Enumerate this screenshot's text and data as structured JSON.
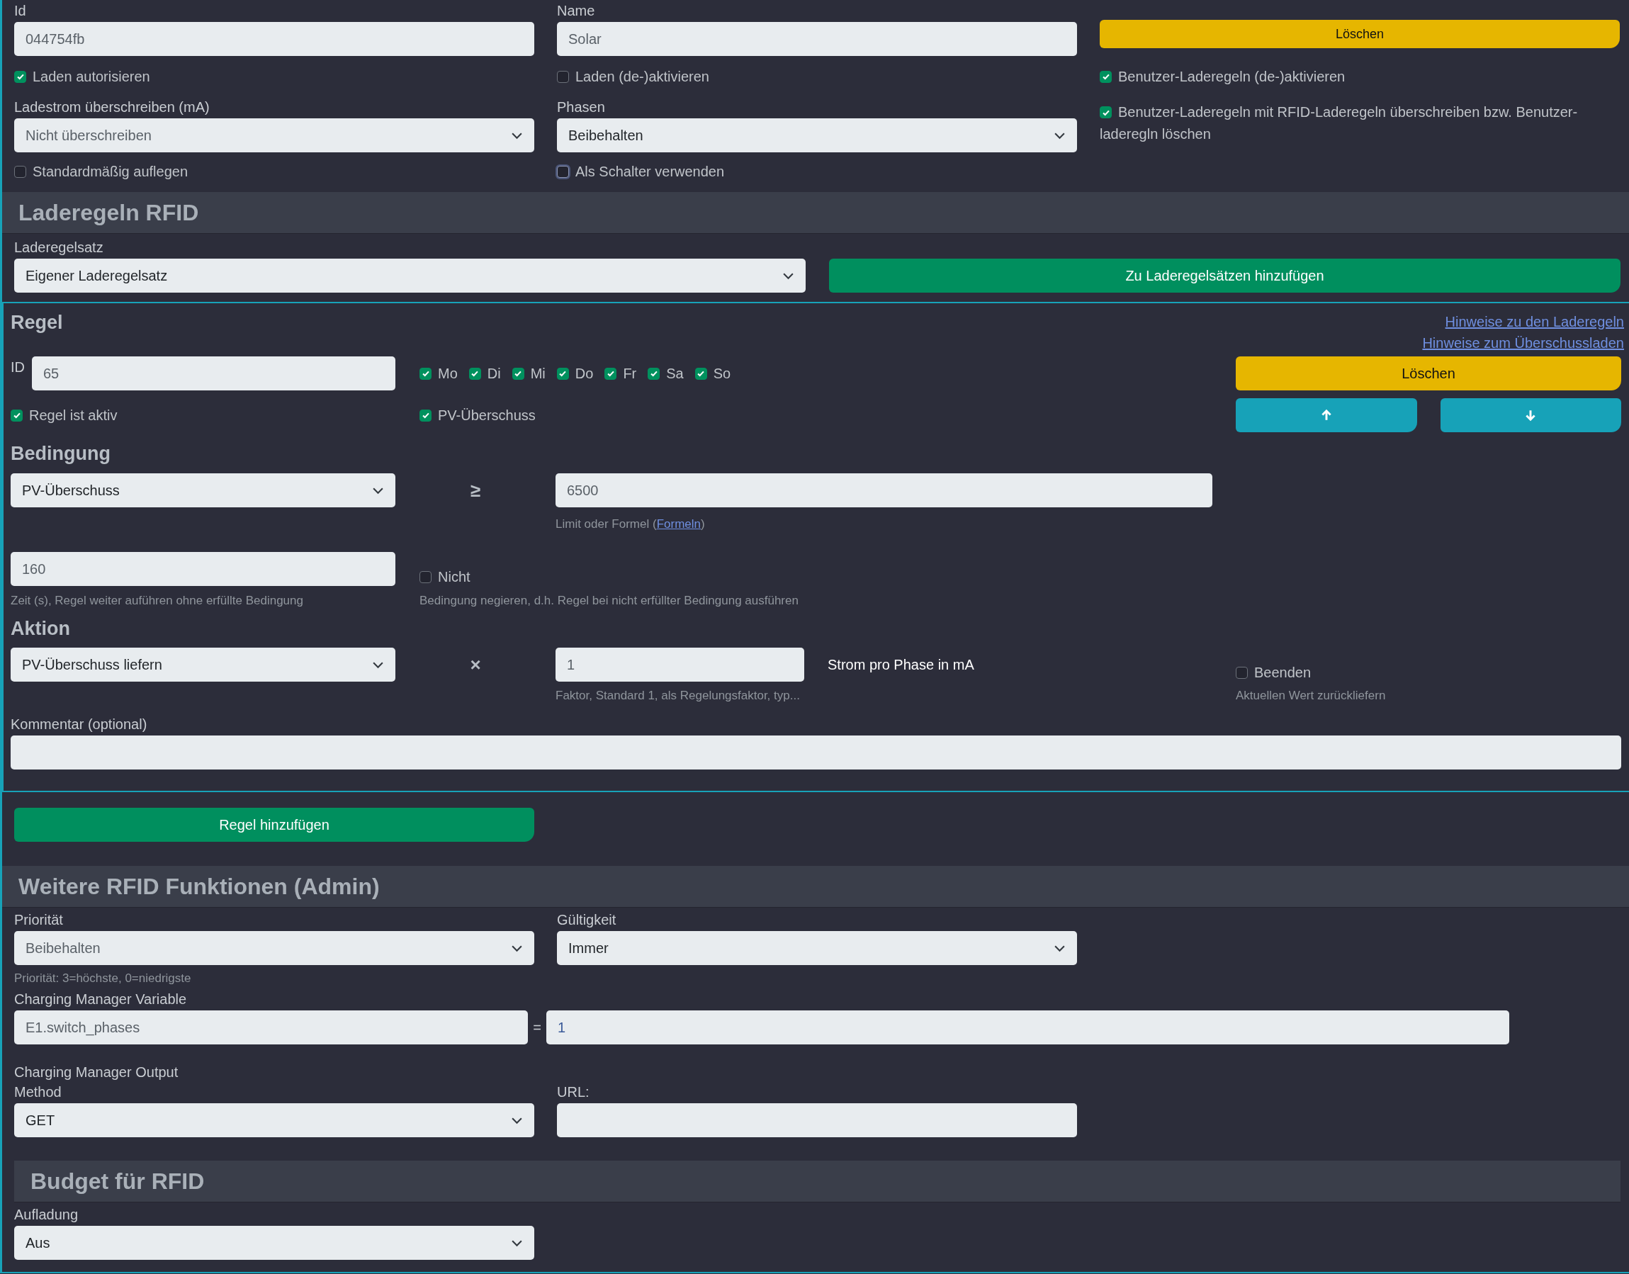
{
  "card": {
    "id_field": {
      "label": "Id",
      "value": "044754fb"
    },
    "name_field": {
      "label": "Name",
      "value": "Solar"
    },
    "delete_button": "Löschen",
    "checkboxes_row1": [
      {
        "label": "Laden autorisieren",
        "checked": true
      },
      {
        "label": "Laden (de-)aktivieren",
        "checked": false
      },
      {
        "label": "Benutzer-Laderegeln (de-)aktivieren",
        "checked": true
      }
    ],
    "current_override": {
      "label": "Ladestrom überschreiben (mA)",
      "value": "Nicht überschreiben"
    },
    "phases": {
      "label": "Phasen",
      "value": "Beibehalten"
    },
    "override_user_rules": {
      "label": "Benutzer-Laderegeln mit RFID-Laderegeln überschreiben bzw. Benutzer-laderegln löschen",
      "checked": true
    },
    "checkboxes_row2": [
      {
        "label": "Standardmäßig auflegen",
        "checked": false,
        "focused": false
      },
      {
        "label": "Als Schalter verwenden",
        "checked": false,
        "focused": true
      }
    ]
  },
  "rfid_rules": {
    "title": "Laderegeln RFID",
    "ruleset": {
      "label": "Laderegelsatz",
      "value": "Eigener Laderegelsatz"
    },
    "add_to_rulesets_button": "Zu Laderegelsätzen hinzufügen"
  },
  "rule": {
    "title": "Regel",
    "links": [
      "Hinweise zu den Laderegeln",
      "Hinweise zum Überschussladen"
    ],
    "id": {
      "label": "ID",
      "value": "65"
    },
    "days": [
      {
        "label": "Mo",
        "checked": true
      },
      {
        "label": "Di",
        "checked": true
      },
      {
        "label": "Mi",
        "checked": true
      },
      {
        "label": "Do",
        "checked": true
      },
      {
        "label": "Fr",
        "checked": true
      },
      {
        "label": "Sa",
        "checked": true
      },
      {
        "label": "So",
        "checked": true
      }
    ],
    "active": {
      "label": "Regel ist aktiv",
      "checked": true
    },
    "pv_surplus": {
      "label": "PV-Überschuss",
      "checked": true
    },
    "delete_button": "Löschen",
    "condition": {
      "title": "Bedingung",
      "source": "PV-Überschuss",
      "operator": "≥",
      "value": "6500",
      "hint": "Limit oder Formel (",
      "hint_link": "Formeln",
      "hint_end": ")",
      "time_value": "160",
      "time_hint": "Zeit (s), Regel weiter auführen ohne erfüllte Bedingung",
      "negate": {
        "label": "Nicht",
        "checked": false
      },
      "negate_hint": "Bedingung negieren, d.h. Regel bei nicht erfüllter Bedingung ausführen"
    },
    "action": {
      "title": "Aktion",
      "value": "PV-Überschuss liefern",
      "operator": "×",
      "factor": "1",
      "factor_hint": "Faktor, Standard 1, als Regelungsfaktor, typ...",
      "unit": "Strom pro Phase in mA",
      "stop": {
        "label": "Beenden",
        "checked": false
      },
      "stop_hint": "Aktuellen Wert zurückliefern"
    },
    "comment": {
      "label": "Kommentar (optional)"
    }
  },
  "add_rule_button": "Regel hinzufügen",
  "admin": {
    "title": "Weitere RFID Funktionen (Admin)",
    "priority": {
      "label": "Priorität",
      "value": "Beibehalten",
      "hint": "Priorität: 3=höchste, 0=niedrigste"
    },
    "validity": {
      "label": "Gültigkeit",
      "value": "Immer"
    },
    "variable": {
      "label": "Charging Manager Variable",
      "name": "E1.switch_phases",
      "equals": "=",
      "value": "1"
    },
    "output": {
      "label": "Charging Manager Output",
      "method_label": "Method",
      "method": "GET",
      "url_label": "URL:"
    }
  },
  "budget": {
    "title": "Budget für RFID",
    "charging": {
      "label": "Aufladung",
      "value": "Aus"
    }
  }
}
